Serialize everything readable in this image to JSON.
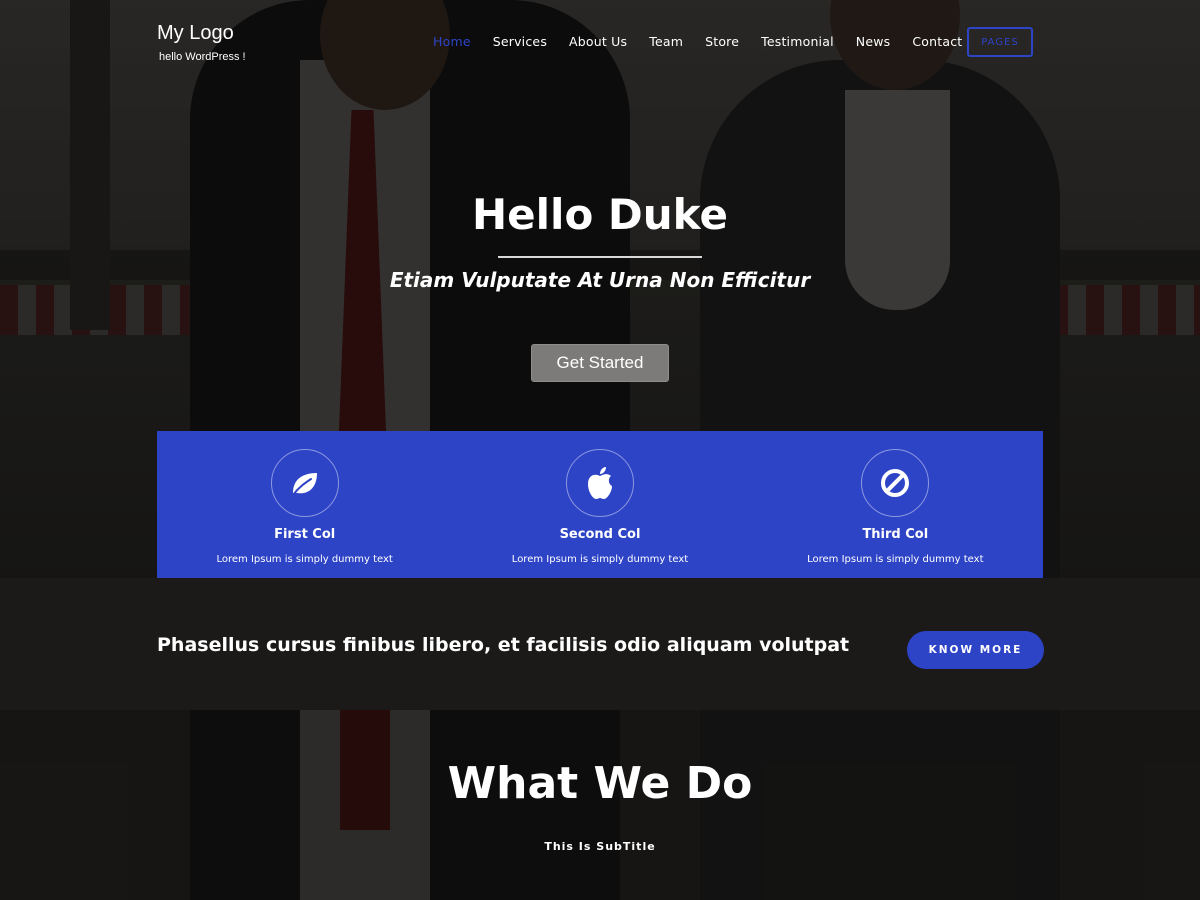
{
  "header": {
    "logo": "My Logo",
    "tagline": "hello WordPress !",
    "nav": [
      "Home",
      "Services",
      "About Us",
      "Team",
      "Store",
      "Testimonial",
      "News",
      "Contact"
    ],
    "active_nav": "Home",
    "pages_button": "PAGES",
    "accent": "#2e44c7"
  },
  "hero": {
    "title": "Hello Duke",
    "subtitle": "Etiam Vulputate At Urna Non Efficitur",
    "cta": "Get Started"
  },
  "features": [
    {
      "icon": "leaf-icon",
      "title": "First Col",
      "text": "Lorem Ipsum is simply dummy text"
    },
    {
      "icon": "apple-icon",
      "title": "Second Col",
      "text": "Lorem Ipsum is simply dummy text"
    },
    {
      "icon": "ban-icon",
      "title": "Third Col",
      "text": "Lorem Ipsum is simply dummy text"
    }
  ],
  "band": {
    "text": "Phasellus cursus finibus libero, et facilisis odio aliquam volutpat",
    "button": "KNOW MORE"
  },
  "section": {
    "title": "What We Do",
    "subtitle": "This Is SubTitle"
  }
}
